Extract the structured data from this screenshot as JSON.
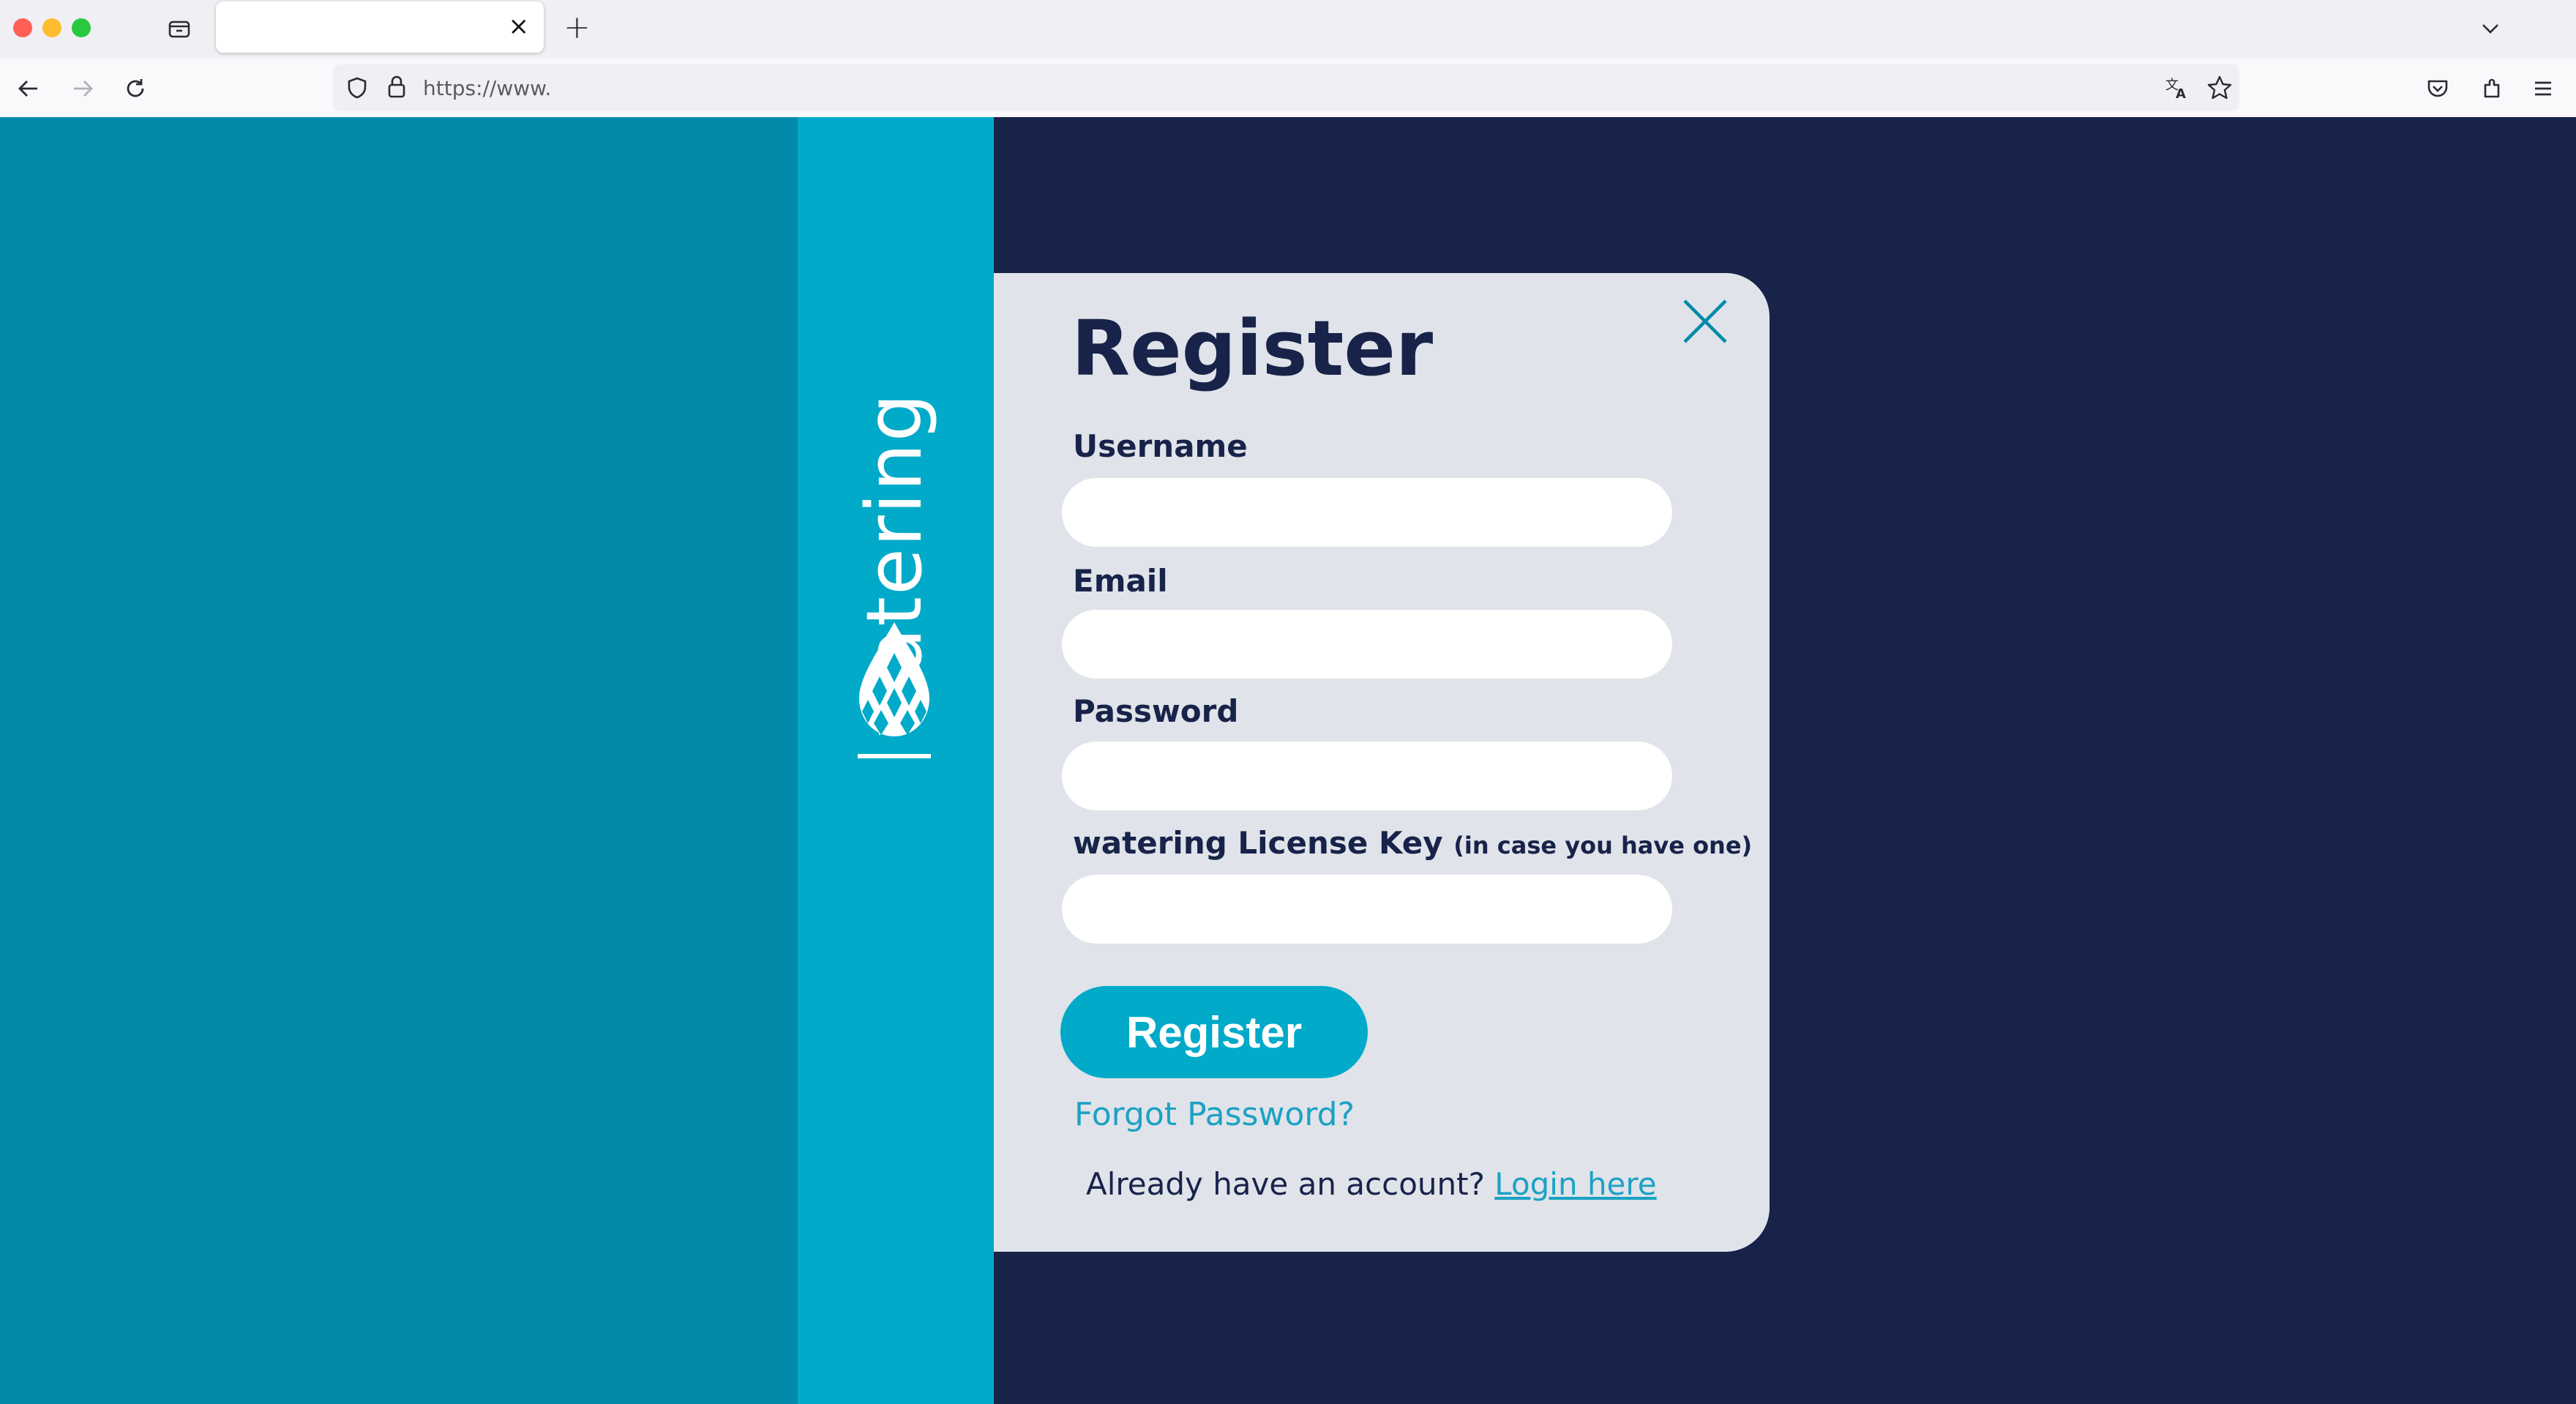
{
  "browser": {
    "tab": {
      "title": "",
      "close_glyph": "×"
    },
    "new_tab_glyph": "+",
    "url": "https://www.",
    "icons": [
      "tab-list-icon",
      "back-icon",
      "forward-icon",
      "reload-icon",
      "shield-icon",
      "lock-icon",
      "translate-icon",
      "bookmark-star-icon",
      "pocket-icon",
      "extensions-icon",
      "menu-icon",
      "tab-overflow-chevron-icon"
    ]
  },
  "brand": {
    "name": "watering",
    "logo_icon": "water-drop-logo-icon"
  },
  "form": {
    "title": "Register",
    "username": {
      "label": "Username",
      "value": "",
      "placeholder": ""
    },
    "email": {
      "label": "Email",
      "value": "",
      "placeholder": ""
    },
    "password": {
      "label": "Password",
      "value": "",
      "placeholder": ""
    },
    "license": {
      "label": "watering License Key",
      "note": "(in case you have one)",
      "value": "",
      "placeholder": ""
    },
    "submit_label": "Register",
    "forgot_label": "Forgot Password?",
    "login_prompt": "Already have an account?",
    "login_link": "Login here"
  },
  "colors": {
    "left_panel": "#038aaa",
    "brand_strip": "#00aac8",
    "background": "#18234a",
    "card": "#e0e3e9",
    "accent": "#00aac8",
    "link": "#1aa2c4",
    "text": "#18234a"
  }
}
